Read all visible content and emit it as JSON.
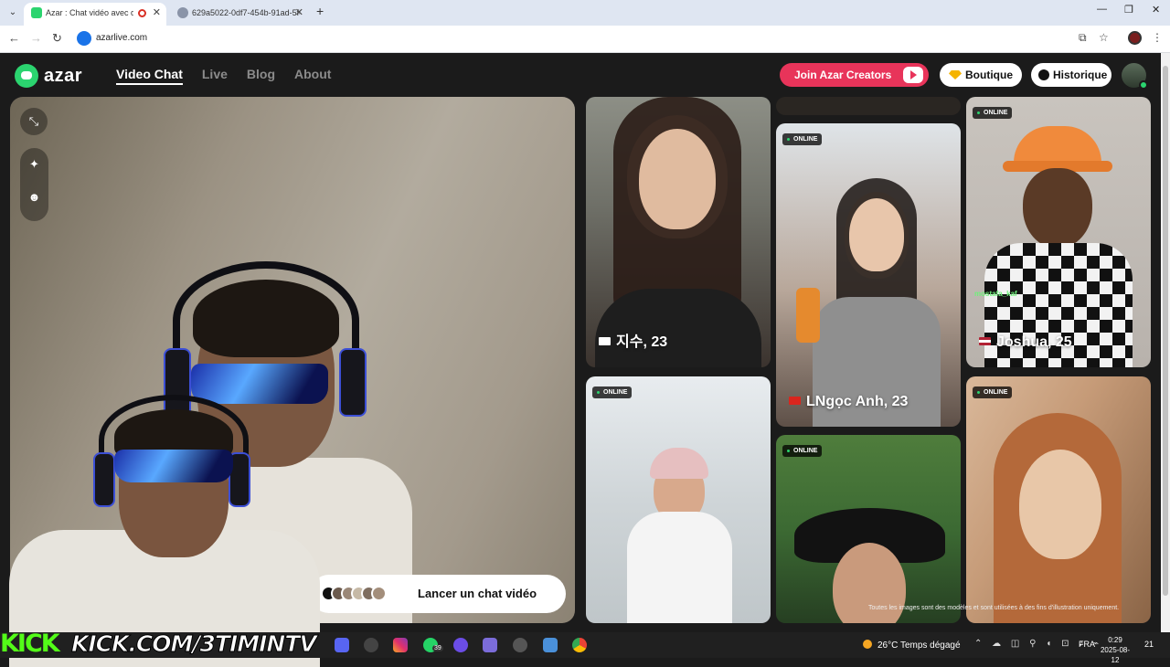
{
  "browser": {
    "tabs": [
      {
        "title": "Azar : Chat vidéo avec de n",
        "active": true,
        "recording": true
      },
      {
        "title": "629a5022-0df7-454b-91ad-5f0",
        "active": false
      }
    ],
    "url": "azarlive.com"
  },
  "site": {
    "logo": "azar",
    "nav": [
      "Video Chat",
      "Live",
      "Blog",
      "About"
    ],
    "active_nav": "Video Chat",
    "creators_button": "Join Azar Creators",
    "boutique_button": "Boutique",
    "history_button": "Historique",
    "launch_button": "Lancer un chat vidéo",
    "disclaimer": "Toutes les images sont des modèles et sont utilisées à des fins d'illustration uniquement.",
    "online_label": "ONLINE",
    "profiles": [
      {
        "name": "지수, 23",
        "flag": "kr"
      },
      {
        "name": "LNgọc Anh, 23",
        "flag": "vn"
      },
      {
        "name": "Joshua, 25",
        "flag": "us"
      }
    ],
    "chat_user": "mostafa_kaf"
  },
  "taskbar": {
    "weather": "26°C  Temps dégagé",
    "language": "FRA",
    "time": "0:29",
    "date": "2025-08-12",
    "whatsapp_badge": "39",
    "notifications": "21"
  },
  "overlay": {
    "kick_logo": "KICK",
    "kick_url": "KICK.COM/3TIMINTV"
  },
  "colors": {
    "accent_green": "#2bd46f",
    "creators_red": "#e8345a",
    "kick_green": "#53fc18"
  }
}
